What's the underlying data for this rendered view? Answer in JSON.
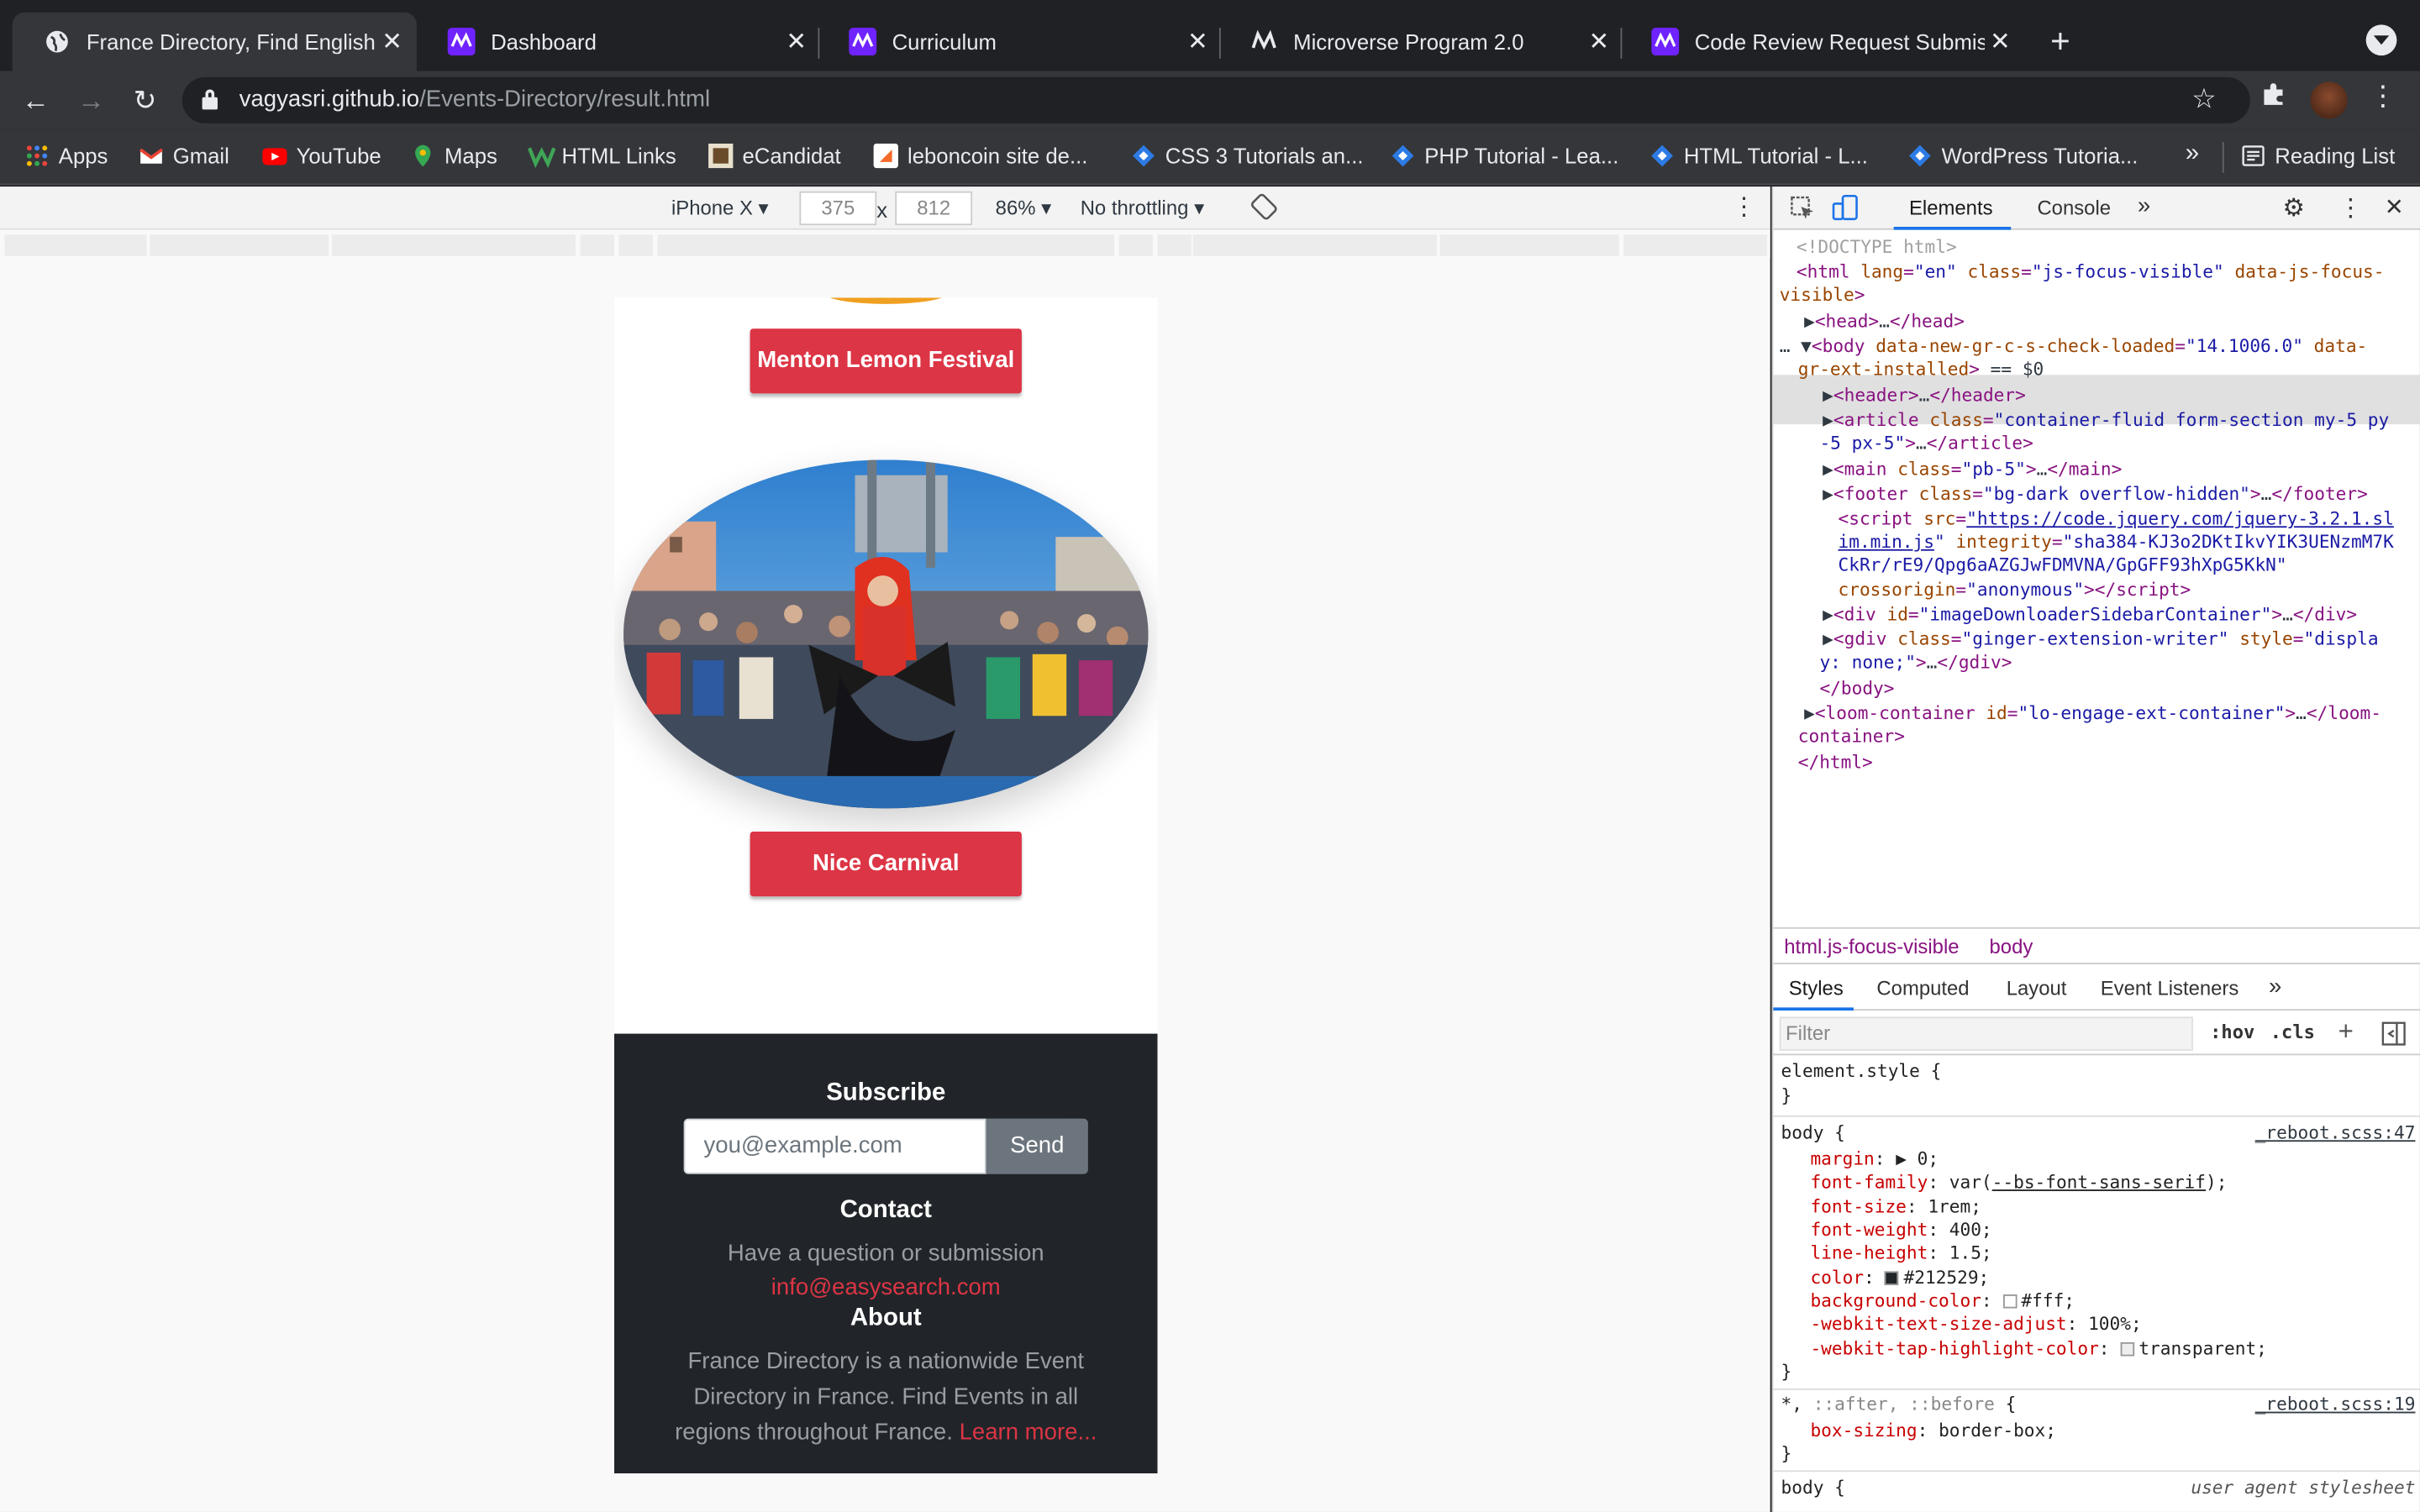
{
  "tabs": [
    {
      "title": "France Directory, Find English",
      "active": true
    },
    {
      "title": "Dashboard"
    },
    {
      "title": "Curriculum"
    },
    {
      "title": "Microverse Program 2.0"
    },
    {
      "title": "Code Review Request Submiss"
    }
  ],
  "omnibox": {
    "host": "vagyasri.github.io",
    "path": "/Events-Directory/result.html"
  },
  "bookmarks": [
    "Apps",
    "Gmail",
    "YouTube",
    "Maps",
    "HTML Links",
    "eCandidat",
    "leboncoin site de...",
    "CSS 3 Tutorials an...",
    "PHP Tutorial - Lea...",
    "HTML Tutorial - L...",
    "WordPress Tutoria..."
  ],
  "bookmarks_overflow": "»",
  "reading_list": "Reading List",
  "device_toolbar": {
    "device": "iPhone X",
    "width": "375",
    "times": "x",
    "height": "812",
    "zoom": "86%",
    "throttling": "No throttling"
  },
  "page": {
    "event1_label": "Menton Lemon Festival",
    "event2_label": "Nice Carnival",
    "subscribe_heading": "Subscribe",
    "email_placeholder": "you@example.com",
    "send_label": "Send",
    "contact_heading": "Contact",
    "contact_text": "Have a question or submission",
    "contact_email": "info@easysearch.com",
    "about_heading": "About",
    "about_line1": "France Directory is a nationwide Event",
    "about_line2": "Directory in France. Find Events in all",
    "about_line3": "regions throughout France.",
    "about_link": "Learn more..."
  },
  "devtools": {
    "tabs": [
      "Elements",
      "Console",
      "»"
    ],
    "breadcrumbs": [
      "html.js-focus-visible",
      "body"
    ],
    "subtabs": [
      "Styles",
      "Computed",
      "Layout",
      "Event Listeners",
      "»"
    ],
    "filter_placeholder": "Filter",
    "hov": ":hov",
    "cls": ".cls",
    "plus": "+",
    "source1": "_reboot.scss:47",
    "source2": "_reboot.scss:19",
    "source3": "user agent stylesheet"
  },
  "colors": {
    "accent": "#dc3545",
    "footer_bg": "#212529",
    "send_bg": "#6c757d",
    "body_color": "#212529"
  }
}
